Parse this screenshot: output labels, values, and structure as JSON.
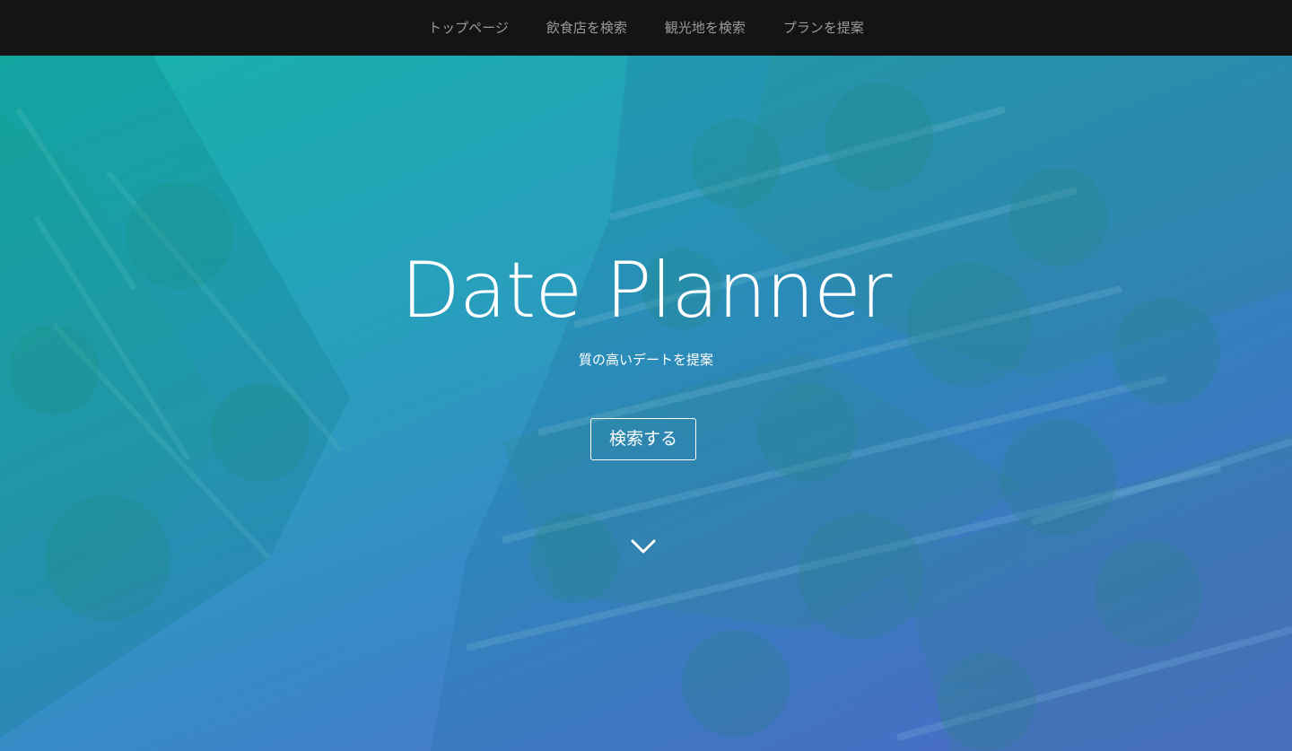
{
  "nav": {
    "items": [
      {
        "label": "トップページ"
      },
      {
        "label": "飲食店を検索"
      },
      {
        "label": "観光地を検索"
      },
      {
        "label": "プランを提案"
      }
    ]
  },
  "hero": {
    "title": "Date Planner",
    "subtitle": "質の高いデートを提案",
    "search_button_label": "検索する",
    "scroll_icon": "chevron-down-icon"
  },
  "colors": {
    "navbar_bg": "#141414",
    "nav_text": "#9a9a9a",
    "gradient_start": "#1ab8b0",
    "gradient_end": "#6a70dc",
    "hero_text": "#ffffff"
  }
}
